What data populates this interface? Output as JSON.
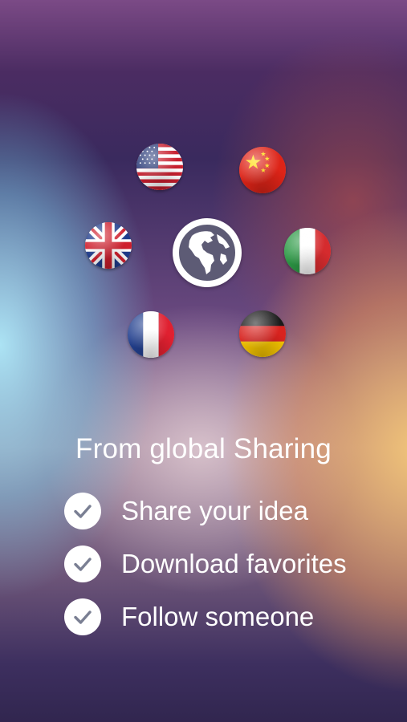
{
  "headline": "From global Sharing",
  "flags": [
    {
      "name": "usa-flag-icon"
    },
    {
      "name": "china-flag-icon"
    },
    {
      "name": "uk-flag-icon"
    },
    {
      "name": "italy-flag-icon"
    },
    {
      "name": "france-flag-icon"
    },
    {
      "name": "germany-flag-icon"
    }
  ],
  "center_icon": "globe-icon",
  "features": [
    {
      "label": "Share your idea",
      "icon": "checkmark-icon"
    },
    {
      "label": "Download favorites",
      "icon": "checkmark-icon"
    },
    {
      "label": "Follow someone",
      "icon": "checkmark-icon"
    }
  ],
  "colors": {
    "check_mark": "#7a7f93",
    "text": "#ffffff"
  }
}
